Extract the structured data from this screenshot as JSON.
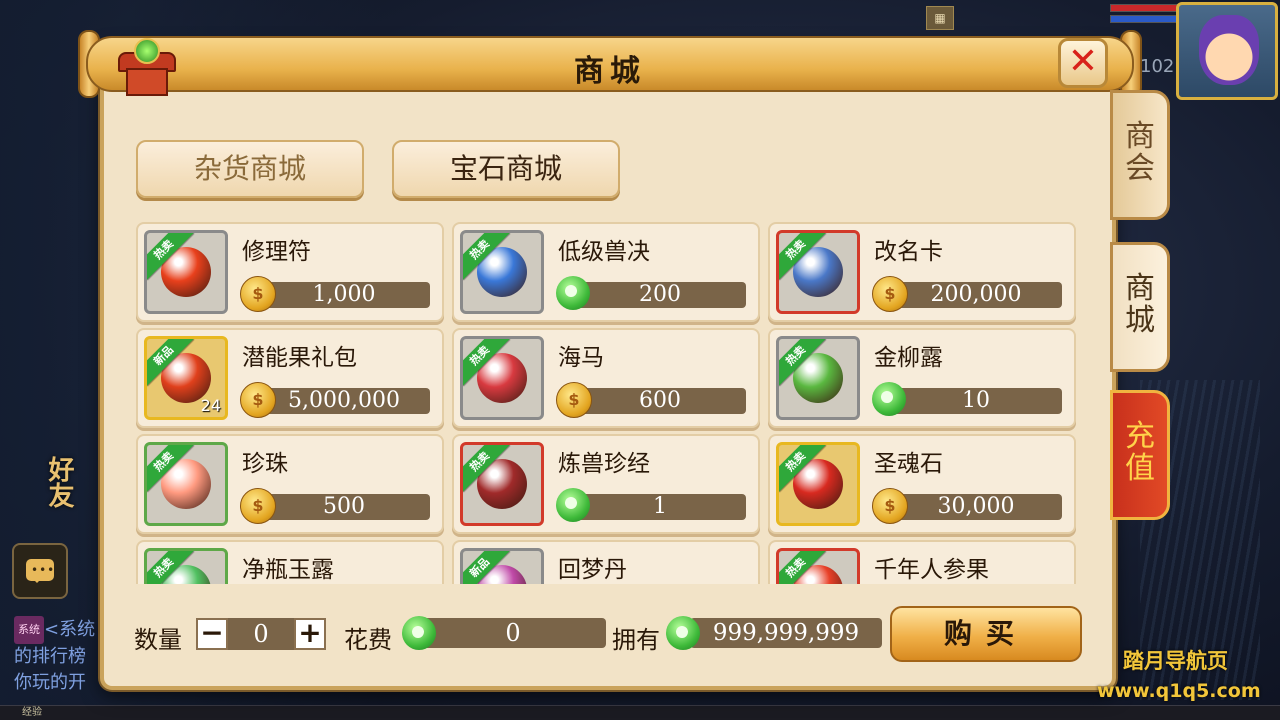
{
  "title": "商城",
  "close_label": "✕",
  "categories": [
    {
      "label": "杂货商城",
      "selected": true
    },
    {
      "label": "宝石商城",
      "selected": false
    }
  ],
  "items": [
    {
      "name": "修理符",
      "price": "1,000",
      "currency": "gold",
      "badge": "热卖",
      "quality": "gray",
      "art_color": "#e8401c"
    },
    {
      "name": "低级兽决",
      "price": "200",
      "currency": "jade",
      "badge": "热卖",
      "quality": "gray",
      "art_color": "#3a78d8"
    },
    {
      "name": "改名卡",
      "price": "200,000",
      "currency": "gold",
      "badge": "热卖",
      "quality": "red",
      "art_color": "#4a78c8"
    },
    {
      "name": "潜能果礼包",
      "price": "5,000,000",
      "currency": "gold",
      "badge": "新品",
      "quality": "gold",
      "art_color": "#e0401c",
      "count": "24"
    },
    {
      "name": "海马",
      "price": "600",
      "currency": "gold",
      "badge": "热卖",
      "quality": "gray",
      "art_color": "#d83a40"
    },
    {
      "name": "金柳露",
      "price": "10",
      "currency": "jade",
      "badge": "热卖",
      "quality": "gray",
      "art_color": "#5ab840"
    },
    {
      "name": "珍珠",
      "price": "500",
      "currency": "gold",
      "badge": "热卖",
      "quality": "green",
      "art_color": "#ff9a80"
    },
    {
      "name": "炼兽珍经",
      "price": "1",
      "currency": "jade",
      "badge": "热卖",
      "quality": "red",
      "art_color": "#a02a2a"
    },
    {
      "name": "圣魂石",
      "price": "30,000",
      "currency": "gold",
      "badge": "热卖",
      "quality": "gold",
      "art_color": "#d82a20"
    },
    {
      "name": "净瓶玉露",
      "price": "",
      "currency": "gold",
      "badge": "热卖",
      "quality": "green",
      "art_color": "#50c060"
    },
    {
      "name": "回梦丹",
      "price": "",
      "currency": "gold",
      "badge": "新品",
      "quality": "gray",
      "art_color": "#c04aa8"
    },
    {
      "name": "千年人参果",
      "price": "",
      "currency": "gold",
      "badge": "热卖",
      "quality": "red",
      "art_color": "#e84028"
    }
  ],
  "footer": {
    "qty_label": "数量",
    "qty_minus": "−",
    "qty_value": "0",
    "qty_plus": "+",
    "cost_label": "花费",
    "cost_value": "0",
    "have_label": "拥有",
    "have_value": "999,999,999",
    "buy_label": "购买"
  },
  "side_tabs": [
    {
      "label": "商会",
      "state": "normal"
    },
    {
      "label": "商城",
      "state": "active"
    },
    {
      "label": "充值",
      "state": "recharge"
    }
  ],
  "hud": {
    "level": "102",
    "corner_icon": "▦"
  },
  "left": {
    "friend_label": "好友",
    "chat_dots": "•••",
    "system_tag": "系统",
    "chat_line1": "<系统",
    "chat_line2": "的排行榜",
    "chat_line3": "你玩的开"
  },
  "bottom_bar": "经验",
  "watermark": {
    "line1": "踏月导航页",
    "line2": "www.q1q5.com"
  },
  "colors": {
    "accent_gold": "#e9b24c",
    "panel_bg": "#f2e3c7",
    "price_bar": "#7a6448",
    "badge_green": "#2fa83a",
    "recharge_red": "#c8301c"
  }
}
